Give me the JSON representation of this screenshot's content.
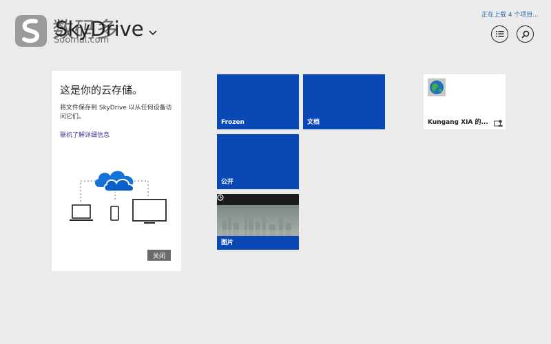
{
  "watermark": {
    "cn": "数码多",
    "en": "Soomal.com"
  },
  "header": {
    "title": "SkyDrive",
    "upload_status": "正在上载 4 个项目..."
  },
  "info_panel": {
    "heading": "这是你的云存储。",
    "body": "将文件保存到 SkyDrive 以从任何设备访问它们。",
    "link": "联机了解详细信息",
    "close_label": "关闭"
  },
  "tiles": [
    {
      "label": "Frozen"
    },
    {
      "label": "文档"
    },
    {
      "label": "公开"
    },
    {
      "label": "图片"
    },
    {
      "label": "Kungang XIA 的..."
    }
  ],
  "icons": {
    "view": "list-icon",
    "search": "search-icon",
    "title_dropdown": "chevron-down-icon",
    "pictures_tile": "clock-icon",
    "shared_tile": "shared-folder-icon",
    "shared_thumb": "globe-icon",
    "illustration": "cloud-devices-icon"
  },
  "colors": {
    "tile_blue": "#0a49b5",
    "background": "#ebebeb",
    "link": "#4a2f9a"
  }
}
